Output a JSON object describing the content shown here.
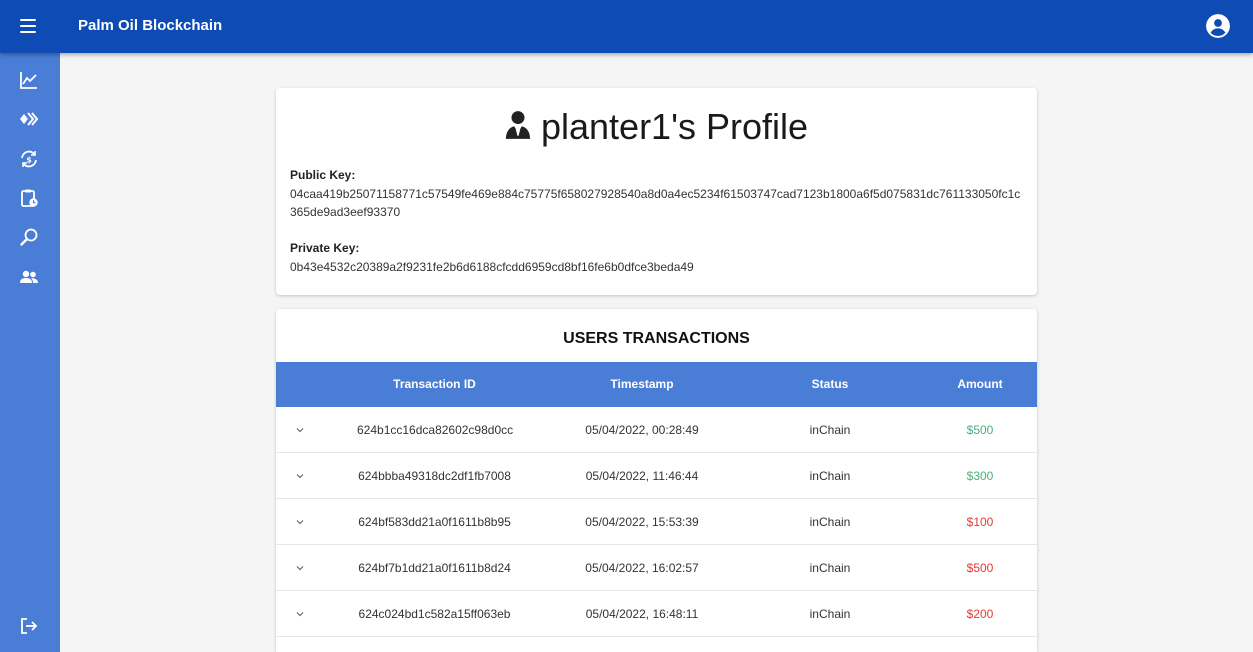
{
  "appbar": {
    "title": "Palm Oil Blockchain"
  },
  "icons": {
    "menu": "hamburger-menu-icon",
    "account": "account-circle-icon",
    "nav": [
      "chart-line-icon",
      "blockchain-icon",
      "currency-exchange-icon",
      "clipboard-clock-icon",
      "search-icon",
      "users-icon"
    ],
    "logout": "logout-icon",
    "profile": "user-tie-icon"
  },
  "profile": {
    "title": "planter1's Profile",
    "public_key_label": "Public Key:",
    "public_key": "04caa419b25071158771c57549fe469e884c75775f658027928540a8d0a4ec5234f61503747cad7123b1800a6f5d075831dc761133050fc1c365de9ad3eef93370",
    "private_key_label": "Private Key:",
    "private_key": "0b43e4532c20389a2f9231fe2b6d6188cfcdd6959cd8bf16fe6b0dfce3beda49"
  },
  "transactions": {
    "title": "USERS TRANSACTIONS",
    "columns": [
      "Transaction ID",
      "Timestamp",
      "Status",
      "Amount"
    ],
    "rows": [
      {
        "id": "624b1cc16dca82602c98d0cc",
        "timestamp": "05/04/2022, 00:28:49",
        "status": "inChain",
        "amount": "$500"
      },
      {
        "id": "624bbba49318dc2df1fb7008",
        "timestamp": "05/04/2022, 11:46:44",
        "status": "inChain",
        "amount": "$300"
      },
      {
        "id": "624bf583dd21a0f1611b8b95",
        "timestamp": "05/04/2022, 15:53:39",
        "status": "inChain",
        "amount": "$100"
      },
      {
        "id": "624bf7b1dd21a0f1611b8d24",
        "timestamp": "05/04/2022, 16:02:57",
        "status": "inChain",
        "amount": "$500"
      },
      {
        "id": "624c024bd1c582a15ff063eb",
        "timestamp": "05/04/2022, 16:48:11",
        "status": "inChain",
        "amount": "$200"
      }
    ],
    "amount_colors": [
      "#4caf7d",
      "#4caf7d",
      "#e53935",
      "#e53935",
      "#e53935"
    ]
  },
  "colors": {
    "appbar": "#0f4bb4",
    "sidebar": "#4a7dd6",
    "table_header": "#4a7dd6",
    "positive": "#4caf7d",
    "negative": "#e53935"
  }
}
